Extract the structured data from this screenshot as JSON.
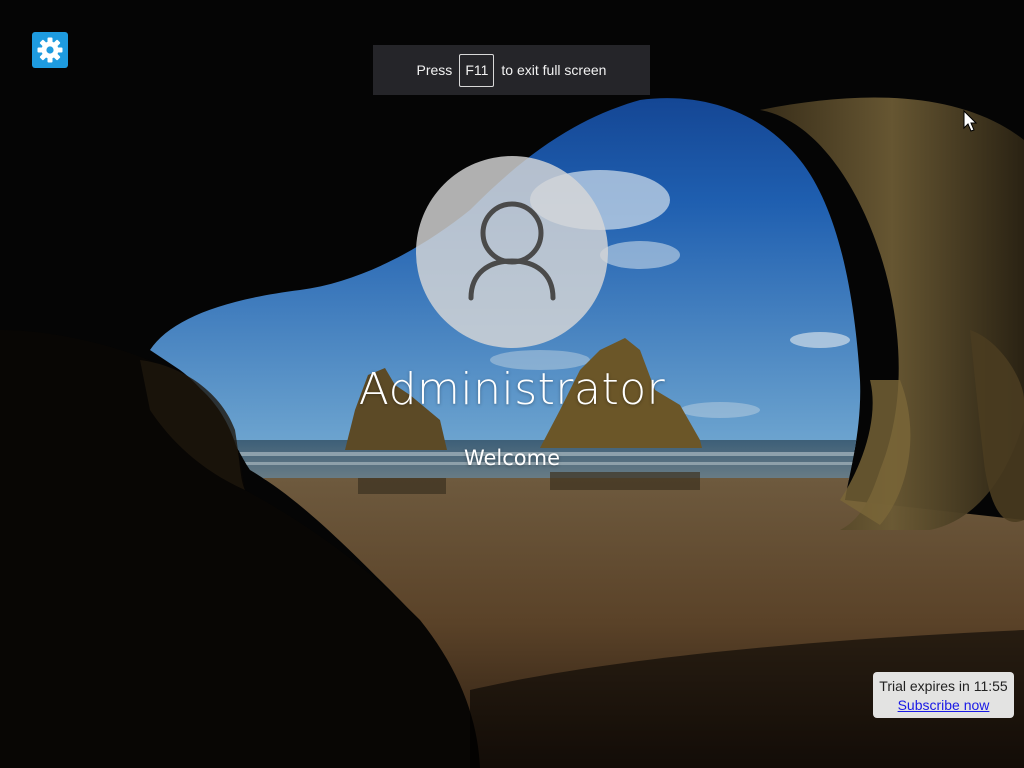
{
  "fullscreen_hint": {
    "prefix": "Press",
    "key": "F11",
    "suffix": "to exit full screen"
  },
  "settings": {
    "icon": "gear-icon",
    "color": "#1e9be0"
  },
  "login": {
    "avatar_icon": "user-icon",
    "username": "Administrator",
    "status": "Welcome"
  },
  "trial": {
    "message": "Trial expires in 11:55",
    "link": "Subscribe now"
  }
}
